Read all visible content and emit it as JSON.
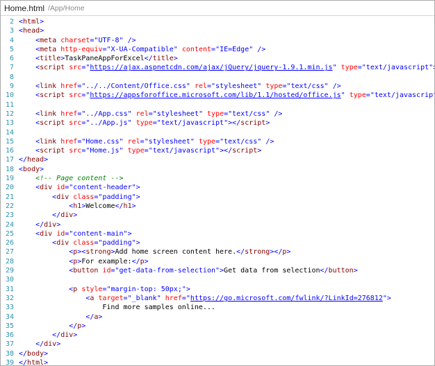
{
  "tab": {
    "file_name": "Home.html",
    "path": "/App/Home"
  },
  "colors": {
    "line_number": "#2b91af",
    "bracket": "#0000ff",
    "tag": "#800000",
    "attribute": "#ff0000",
    "value": "#0000ff",
    "comment": "#008000",
    "text": "#000000"
  },
  "lines": [
    {
      "n": "2",
      "indent": 0,
      "tokens": [
        [
          "b",
          "<"
        ],
        [
          "tag",
          "html"
        ],
        [
          "b",
          ">"
        ]
      ]
    },
    {
      "n": "3",
      "indent": 0,
      "tokens": [
        [
          "b",
          "<"
        ],
        [
          "tag",
          "head"
        ],
        [
          "b",
          ">"
        ]
      ]
    },
    {
      "n": "4",
      "indent": 4,
      "tokens": [
        [
          "b",
          "<"
        ],
        [
          "tag",
          "meta"
        ],
        [
          "t",
          " "
        ],
        [
          "attr",
          "charset"
        ],
        [
          "b",
          "="
        ],
        [
          "val",
          "\"UTF-8\""
        ],
        [
          "t",
          " "
        ],
        [
          "b",
          "/>"
        ]
      ]
    },
    {
      "n": "5",
      "indent": 4,
      "tokens": [
        [
          "b",
          "<"
        ],
        [
          "tag",
          "meta"
        ],
        [
          "t",
          " "
        ],
        [
          "attr",
          "http-equiv"
        ],
        [
          "b",
          "="
        ],
        [
          "val",
          "\"X-UA-Compatible\""
        ],
        [
          "t",
          " "
        ],
        [
          "attr",
          "content"
        ],
        [
          "b",
          "="
        ],
        [
          "val",
          "\"IE=Edge\""
        ],
        [
          "t",
          " "
        ],
        [
          "b",
          "/>"
        ]
      ]
    },
    {
      "n": "6",
      "indent": 4,
      "tokens": [
        [
          "b",
          "<"
        ],
        [
          "tag",
          "title"
        ],
        [
          "b",
          ">"
        ],
        [
          "text",
          "TaskPaneAppForExcel"
        ],
        [
          "b",
          "</"
        ],
        [
          "tag",
          "title"
        ],
        [
          "b",
          ">"
        ]
      ]
    },
    {
      "n": "7",
      "indent": 4,
      "tokens": [
        [
          "b",
          "<"
        ],
        [
          "tag",
          "script"
        ],
        [
          "t",
          " "
        ],
        [
          "attr",
          "src"
        ],
        [
          "b",
          "="
        ],
        [
          "val",
          "\""
        ],
        [
          "link",
          "https://ajax.aspnetcdn.com/ajax/jQuery/jquery-1.9.1.min.js"
        ],
        [
          "val",
          "\""
        ],
        [
          "t",
          " "
        ],
        [
          "attr",
          "type"
        ],
        [
          "b",
          "="
        ],
        [
          "val",
          "\"text/javascript\""
        ],
        [
          "b",
          "></"
        ],
        [
          "tag",
          "script"
        ],
        [
          "b",
          ">"
        ]
      ]
    },
    {
      "n": "8",
      "indent": 0,
      "tokens": []
    },
    {
      "n": "9",
      "indent": 4,
      "tokens": [
        [
          "b",
          "<"
        ],
        [
          "tag",
          "link"
        ],
        [
          "t",
          " "
        ],
        [
          "attr",
          "href"
        ],
        [
          "b",
          "="
        ],
        [
          "val",
          "\"../../Content/Office.css\""
        ],
        [
          "t",
          " "
        ],
        [
          "attr",
          "rel"
        ],
        [
          "b",
          "="
        ],
        [
          "val",
          "\"stylesheet\""
        ],
        [
          "t",
          " "
        ],
        [
          "attr",
          "type"
        ],
        [
          "b",
          "="
        ],
        [
          "val",
          "\"text/css\""
        ],
        [
          "t",
          " "
        ],
        [
          "b",
          "/>"
        ]
      ]
    },
    {
      "n": "10",
      "indent": 4,
      "tokens": [
        [
          "b",
          "<"
        ],
        [
          "tag",
          "script"
        ],
        [
          "t",
          " "
        ],
        [
          "attr",
          "src"
        ],
        [
          "b",
          "="
        ],
        [
          "val",
          "\""
        ],
        [
          "link",
          "https://appsforoffice.microsoft.com/lib/1.1/hosted/office.js"
        ],
        [
          "val",
          "\""
        ],
        [
          "t",
          " "
        ],
        [
          "attr",
          "type"
        ],
        [
          "b",
          "="
        ],
        [
          "val",
          "\"text/javascript\""
        ],
        [
          "b",
          "></"
        ],
        [
          "tag",
          "script"
        ],
        [
          "b",
          ">"
        ]
      ]
    },
    {
      "n": "11",
      "indent": 0,
      "tokens": []
    },
    {
      "n": "12",
      "indent": 4,
      "tokens": [
        [
          "b",
          "<"
        ],
        [
          "tag",
          "link"
        ],
        [
          "t",
          " "
        ],
        [
          "attr",
          "href"
        ],
        [
          "b",
          "="
        ],
        [
          "val",
          "\"../App.css\""
        ],
        [
          "t",
          " "
        ],
        [
          "attr",
          "rel"
        ],
        [
          "b",
          "="
        ],
        [
          "val",
          "\"stylesheet\""
        ],
        [
          "t",
          " "
        ],
        [
          "attr",
          "type"
        ],
        [
          "b",
          "="
        ],
        [
          "val",
          "\"text/css\""
        ],
        [
          "t",
          " "
        ],
        [
          "b",
          "/>"
        ]
      ]
    },
    {
      "n": "13",
      "indent": 4,
      "tokens": [
        [
          "b",
          "<"
        ],
        [
          "tag",
          "script"
        ],
        [
          "t",
          " "
        ],
        [
          "attr",
          "src"
        ],
        [
          "b",
          "="
        ],
        [
          "val",
          "\"../App.js\""
        ],
        [
          "t",
          " "
        ],
        [
          "attr",
          "type"
        ],
        [
          "b",
          "="
        ],
        [
          "val",
          "\"text/javascript\""
        ],
        [
          "b",
          "></"
        ],
        [
          "tag",
          "script"
        ],
        [
          "b",
          ">"
        ]
      ]
    },
    {
      "n": "14",
      "indent": 0,
      "tokens": []
    },
    {
      "n": "15",
      "indent": 4,
      "tokens": [
        [
          "b",
          "<"
        ],
        [
          "tag",
          "link"
        ],
        [
          "t",
          " "
        ],
        [
          "attr",
          "href"
        ],
        [
          "b",
          "="
        ],
        [
          "val",
          "\"Home.css\""
        ],
        [
          "t",
          " "
        ],
        [
          "attr",
          "rel"
        ],
        [
          "b",
          "="
        ],
        [
          "val",
          "\"stylesheet\""
        ],
        [
          "t",
          " "
        ],
        [
          "attr",
          "type"
        ],
        [
          "b",
          "="
        ],
        [
          "val",
          "\"text/css\""
        ],
        [
          "t",
          " "
        ],
        [
          "b",
          "/>"
        ]
      ]
    },
    {
      "n": "16",
      "indent": 4,
      "tokens": [
        [
          "b",
          "<"
        ],
        [
          "tag",
          "script"
        ],
        [
          "t",
          " "
        ],
        [
          "attr",
          "src"
        ],
        [
          "b",
          "="
        ],
        [
          "val",
          "\"Home.js\""
        ],
        [
          "t",
          " "
        ],
        [
          "attr",
          "type"
        ],
        [
          "b",
          "="
        ],
        [
          "val",
          "\"text/javascript\""
        ],
        [
          "b",
          "></"
        ],
        [
          "tag",
          "script"
        ],
        [
          "b",
          ">"
        ]
      ]
    },
    {
      "n": "17",
      "indent": 0,
      "tokens": [
        [
          "b",
          "</"
        ],
        [
          "tag",
          "head"
        ],
        [
          "b",
          ">"
        ]
      ]
    },
    {
      "n": "18",
      "indent": 0,
      "tokens": [
        [
          "b",
          "<"
        ],
        [
          "tag",
          "body"
        ],
        [
          "b",
          ">"
        ]
      ]
    },
    {
      "n": "19",
      "indent": 4,
      "tokens": [
        [
          "comment",
          "<!-- Page content -->"
        ]
      ]
    },
    {
      "n": "20",
      "indent": 4,
      "tokens": [
        [
          "b",
          "<"
        ],
        [
          "tag",
          "div"
        ],
        [
          "t",
          " "
        ],
        [
          "attr",
          "id"
        ],
        [
          "b",
          "="
        ],
        [
          "val",
          "\"content-header\""
        ],
        [
          "b",
          ">"
        ]
      ]
    },
    {
      "n": "21",
      "indent": 8,
      "tokens": [
        [
          "b",
          "<"
        ],
        [
          "tag",
          "div"
        ],
        [
          "t",
          " "
        ],
        [
          "attr",
          "class"
        ],
        [
          "b",
          "="
        ],
        [
          "val",
          "\"padding\""
        ],
        [
          "b",
          ">"
        ]
      ]
    },
    {
      "n": "22",
      "indent": 12,
      "tokens": [
        [
          "b",
          "<"
        ],
        [
          "tag",
          "h1"
        ],
        [
          "b",
          ">"
        ],
        [
          "text",
          "Welcome"
        ],
        [
          "b",
          "</"
        ],
        [
          "tag",
          "h1"
        ],
        [
          "b",
          ">"
        ]
      ]
    },
    {
      "n": "23",
      "indent": 8,
      "tokens": [
        [
          "b",
          "</"
        ],
        [
          "tag",
          "div"
        ],
        [
          "b",
          ">"
        ]
      ]
    },
    {
      "n": "24",
      "indent": 4,
      "tokens": [
        [
          "b",
          "</"
        ],
        [
          "tag",
          "div"
        ],
        [
          "b",
          ">"
        ]
      ]
    },
    {
      "n": "25",
      "indent": 4,
      "tokens": [
        [
          "b",
          "<"
        ],
        [
          "tag",
          "div"
        ],
        [
          "t",
          " "
        ],
        [
          "attr",
          "id"
        ],
        [
          "b",
          "="
        ],
        [
          "val",
          "\"content-main\""
        ],
        [
          "b",
          ">"
        ]
      ]
    },
    {
      "n": "26",
      "indent": 8,
      "tokens": [
        [
          "b",
          "<"
        ],
        [
          "tag",
          "div"
        ],
        [
          "t",
          " "
        ],
        [
          "attr",
          "class"
        ],
        [
          "b",
          "="
        ],
        [
          "val",
          "\"padding\""
        ],
        [
          "b",
          ">"
        ]
      ]
    },
    {
      "n": "27",
      "indent": 12,
      "tokens": [
        [
          "b",
          "<"
        ],
        [
          "tag",
          "p"
        ],
        [
          "b",
          "><"
        ],
        [
          "tag",
          "strong"
        ],
        [
          "b",
          ">"
        ],
        [
          "text",
          "Add home screen content here."
        ],
        [
          "b",
          "</"
        ],
        [
          "tag",
          "strong"
        ],
        [
          "b",
          "></"
        ],
        [
          "tag",
          "p"
        ],
        [
          "b",
          ">"
        ]
      ]
    },
    {
      "n": "28",
      "indent": 12,
      "tokens": [
        [
          "b",
          "<"
        ],
        [
          "tag",
          "p"
        ],
        [
          "b",
          ">"
        ],
        [
          "text",
          "For example:"
        ],
        [
          "b",
          "</"
        ],
        [
          "tag",
          "p"
        ],
        [
          "b",
          ">"
        ]
      ]
    },
    {
      "n": "29",
      "indent": 12,
      "tokens": [
        [
          "b",
          "<"
        ],
        [
          "tag",
          "button"
        ],
        [
          "t",
          " "
        ],
        [
          "attr",
          "id"
        ],
        [
          "b",
          "="
        ],
        [
          "val",
          "\"get-data-from-selection\""
        ],
        [
          "b",
          ">"
        ],
        [
          "text",
          "Get data from selection"
        ],
        [
          "b",
          "</"
        ],
        [
          "tag",
          "button"
        ],
        [
          "b",
          ">"
        ]
      ]
    },
    {
      "n": "30",
      "indent": 0,
      "tokens": []
    },
    {
      "n": "31",
      "indent": 12,
      "tokens": [
        [
          "b",
          "<"
        ],
        [
          "tag",
          "p"
        ],
        [
          "t",
          " "
        ],
        [
          "attr",
          "style"
        ],
        [
          "b",
          "="
        ],
        [
          "val",
          "\"margin-top: 50px;\""
        ],
        [
          "b",
          ">"
        ]
      ]
    },
    {
      "n": "32",
      "indent": 16,
      "tokens": [
        [
          "b",
          "<"
        ],
        [
          "tag",
          "a"
        ],
        [
          "t",
          " "
        ],
        [
          "attr",
          "target"
        ],
        [
          "b",
          "="
        ],
        [
          "val",
          "\"_blank\""
        ],
        [
          "t",
          " "
        ],
        [
          "attr",
          "href"
        ],
        [
          "b",
          "="
        ],
        [
          "val",
          "\""
        ],
        [
          "link",
          "https://go.microsoft.com/fwlink/?LinkId=276812"
        ],
        [
          "val",
          "\""
        ],
        [
          "b",
          ">"
        ]
      ]
    },
    {
      "n": "33",
      "indent": 20,
      "tokens": [
        [
          "text",
          "Find more samples online..."
        ]
      ]
    },
    {
      "n": "34",
      "indent": 16,
      "tokens": [
        [
          "b",
          "</"
        ],
        [
          "tag",
          "a"
        ],
        [
          "b",
          ">"
        ]
      ]
    },
    {
      "n": "35",
      "indent": 12,
      "tokens": [
        [
          "b",
          "</"
        ],
        [
          "tag",
          "p"
        ],
        [
          "b",
          ">"
        ]
      ]
    },
    {
      "n": "36",
      "indent": 8,
      "tokens": [
        [
          "b",
          "</"
        ],
        [
          "tag",
          "div"
        ],
        [
          "b",
          ">"
        ]
      ]
    },
    {
      "n": "37",
      "indent": 4,
      "tokens": [
        [
          "b",
          "</"
        ],
        [
          "tag",
          "div"
        ],
        [
          "b",
          ">"
        ]
      ]
    },
    {
      "n": "38",
      "indent": 0,
      "tokens": [
        [
          "b",
          "</"
        ],
        [
          "tag",
          "body"
        ],
        [
          "b",
          ">"
        ]
      ]
    },
    {
      "n": "39",
      "indent": 0,
      "tokens": [
        [
          "b",
          "</"
        ],
        [
          "tag",
          "html"
        ],
        [
          "b",
          ">"
        ]
      ]
    }
  ]
}
